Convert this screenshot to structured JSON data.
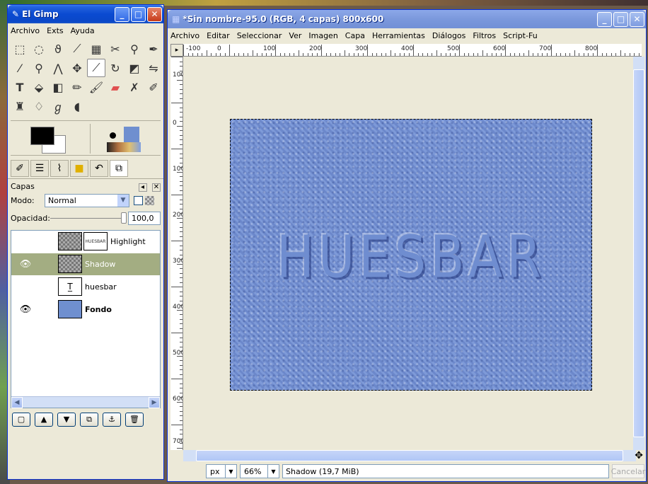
{
  "toolbox": {
    "title": "El Gimp",
    "menu": [
      "Archivo",
      "Exts",
      "Ayuda"
    ],
    "tools": [
      "rect-select",
      "ellipse-select",
      "free-select",
      "fuzzy-select",
      "color-select",
      "scissors",
      "foreground-select",
      "paths",
      "color-picker",
      "zoom",
      "measure",
      "move",
      "crop",
      "rotate",
      "perspective",
      "flip",
      "text",
      "bucket-fill",
      "blend",
      "pencil",
      "paintbrush",
      "eraser",
      "airbrush",
      "ink",
      "clone",
      "heal",
      "smudge",
      "dodge-burn"
    ],
    "layers_panel": {
      "header": "Capas",
      "mode_label": "Modo:",
      "mode_value": "Normal",
      "opacity_label": "Opacidad:",
      "opacity_value": "100,0",
      "layers": [
        {
          "name": "Highlight",
          "visible": false,
          "selected": false
        },
        {
          "name": "Shadow",
          "visible": true,
          "selected": true
        },
        {
          "name": "huesbar",
          "visible": false,
          "selected": false
        },
        {
          "name": "Fondo",
          "visible": true,
          "selected": false
        }
      ]
    }
  },
  "image_window": {
    "title": "*Sin nombre-95.0 (RGB, 4 capas) 800x600",
    "menu": [
      "Archivo",
      "Editar",
      "Seleccionar",
      "Ver",
      "Imagen",
      "Capa",
      "Herramientas",
      "Diálogos",
      "Filtros",
      "Script-Fu"
    ],
    "ruler_h_labels": [
      "-100",
      "0",
      "100",
      "200",
      "300",
      "400",
      "500",
      "600",
      "700",
      "800"
    ],
    "ruler_v_labels": [
      "100",
      "0",
      "100",
      "200",
      "300",
      "400",
      "500",
      "600",
      "700"
    ],
    "canvas_text": "HUESBAR",
    "unit": "px",
    "zoom": "66%",
    "status": "Shadow (19,7 MiB)",
    "cancel_label": "Cancelar"
  }
}
